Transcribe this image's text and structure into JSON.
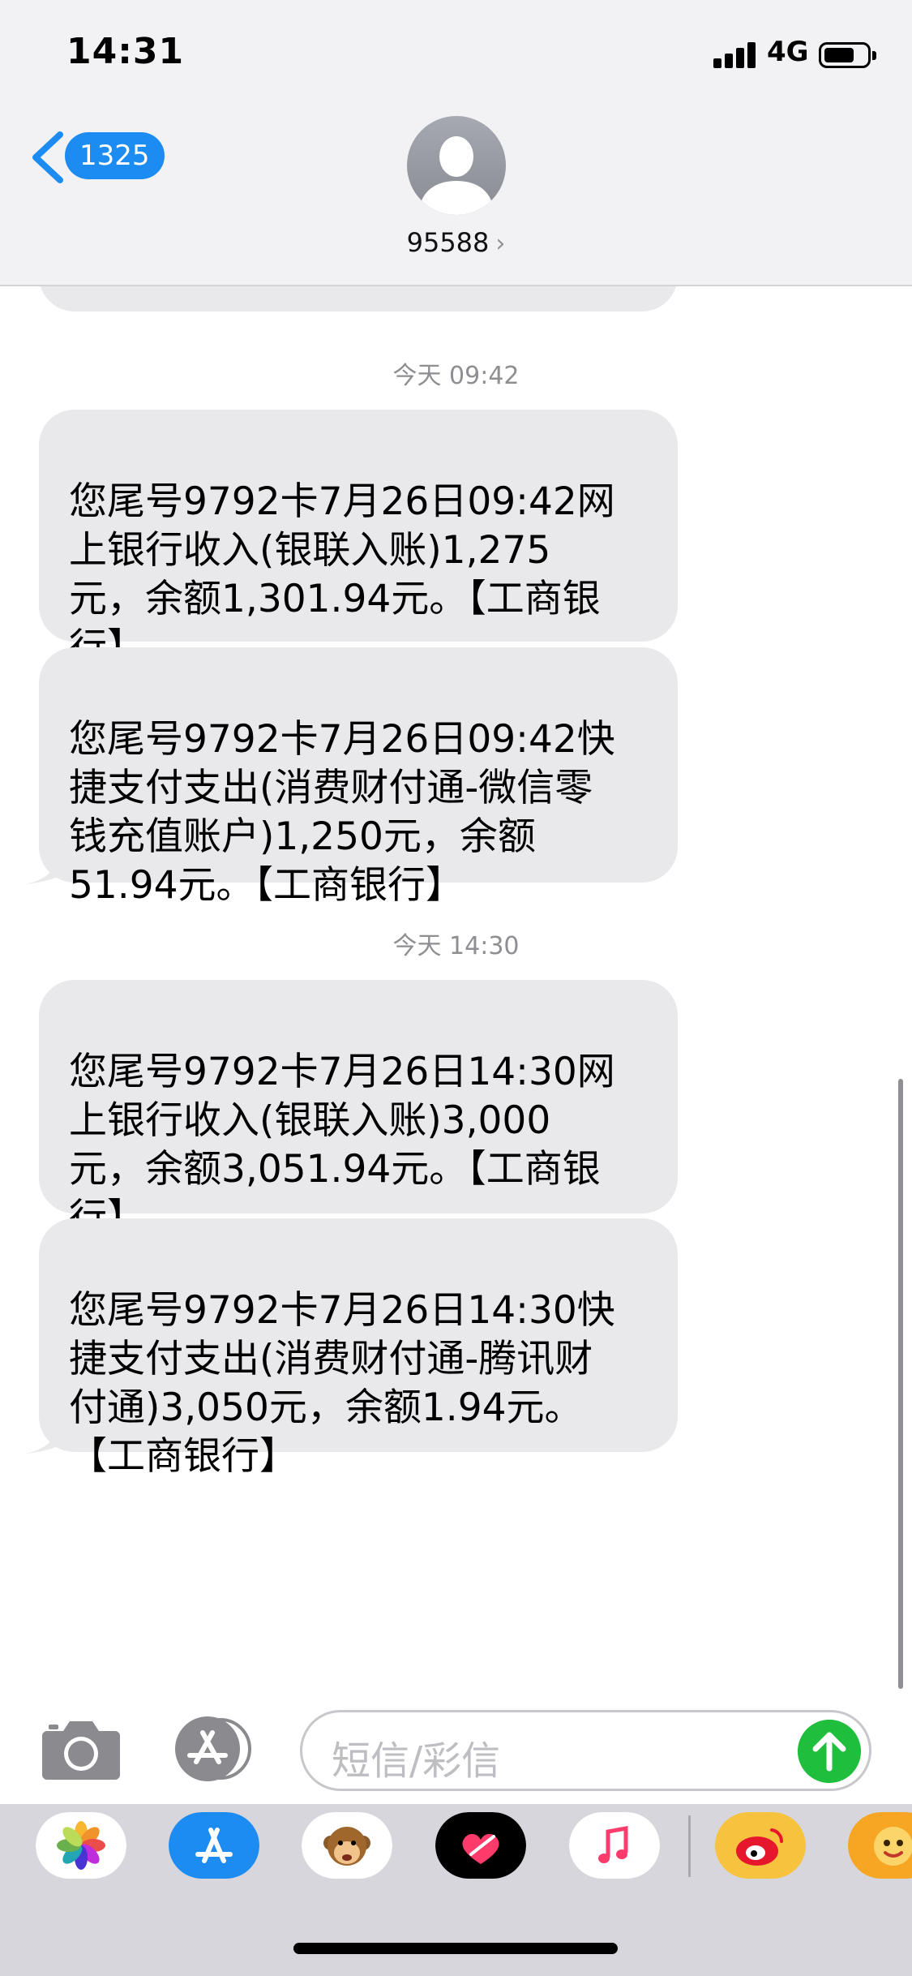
{
  "status_bar": {
    "time": "14:31",
    "network": "4G",
    "battery_percent": 70
  },
  "header": {
    "back_count": "1325",
    "contact": "95588",
    "contact_chevron": "›"
  },
  "composer": {
    "placeholder": "短信/彩信"
  },
  "groups": [
    {
      "timestamp": "今天 09:42",
      "messages": [
        "您尾号9792卡7月26日09:42网\n上银行收入(银联入账)1,275\n元，余额1,301.94元。【工商银\n行】",
        "您尾号9792卡7月26日09:42快\n捷支付支出(消费财付通-微信零\n钱充值账户)1,250元，余额\n51.94元。【工商银行】"
      ]
    },
    {
      "timestamp": "今天 14:30",
      "messages": [
        "您尾号9792卡7月26日14:30网\n上银行收入(银联入账)3,000\n元，余额3,051.94元。【工商银\n行】",
        "您尾号9792卡7月26日14:30快\n捷支付支出(消费财付通-腾讯财\n付通)3,050元，余额1.94元。\n【工商银行】"
      ]
    }
  ],
  "apps": [
    "photos-app-icon",
    "app-store-icon",
    "animoji-icon",
    "digital-touch-icon",
    "music-icon",
    "weibo-icon",
    "sticker-app-icon"
  ],
  "colors": {
    "accent": "#1d8cf2",
    "bubble": "#e9e9eb",
    "send": "#1fbe3c"
  }
}
